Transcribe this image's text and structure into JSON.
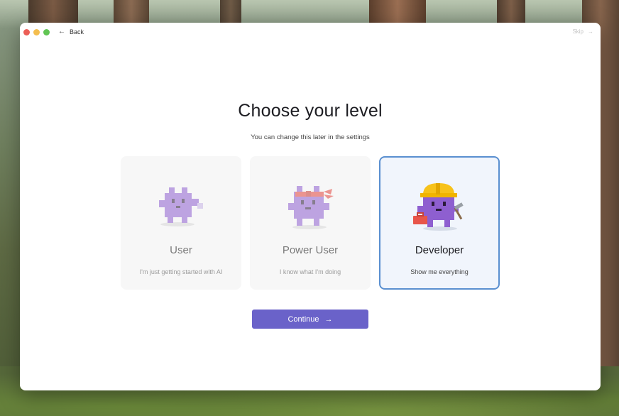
{
  "window": {
    "back_label": "Back",
    "skip_label": "Skip"
  },
  "page": {
    "title": "Choose your level",
    "subtitle": "You can change this later in the settings"
  },
  "levels": [
    {
      "name": "User",
      "description": "I'm just getting started with AI",
      "selected": false,
      "mascot": "purple-creature-icon"
    },
    {
      "name": "Power User",
      "description": "I know what I'm doing",
      "selected": false,
      "mascot": "purple-creature-headband-icon"
    },
    {
      "name": "Developer",
      "description": "Show me everything",
      "selected": true,
      "mascot": "purple-creature-hardhat-icon"
    }
  ],
  "continue_label": "Continue",
  "colors": {
    "accent": "#6a62c9",
    "selected_border": "#5a8fd0",
    "mascot_purple": "#8e5fd0"
  }
}
